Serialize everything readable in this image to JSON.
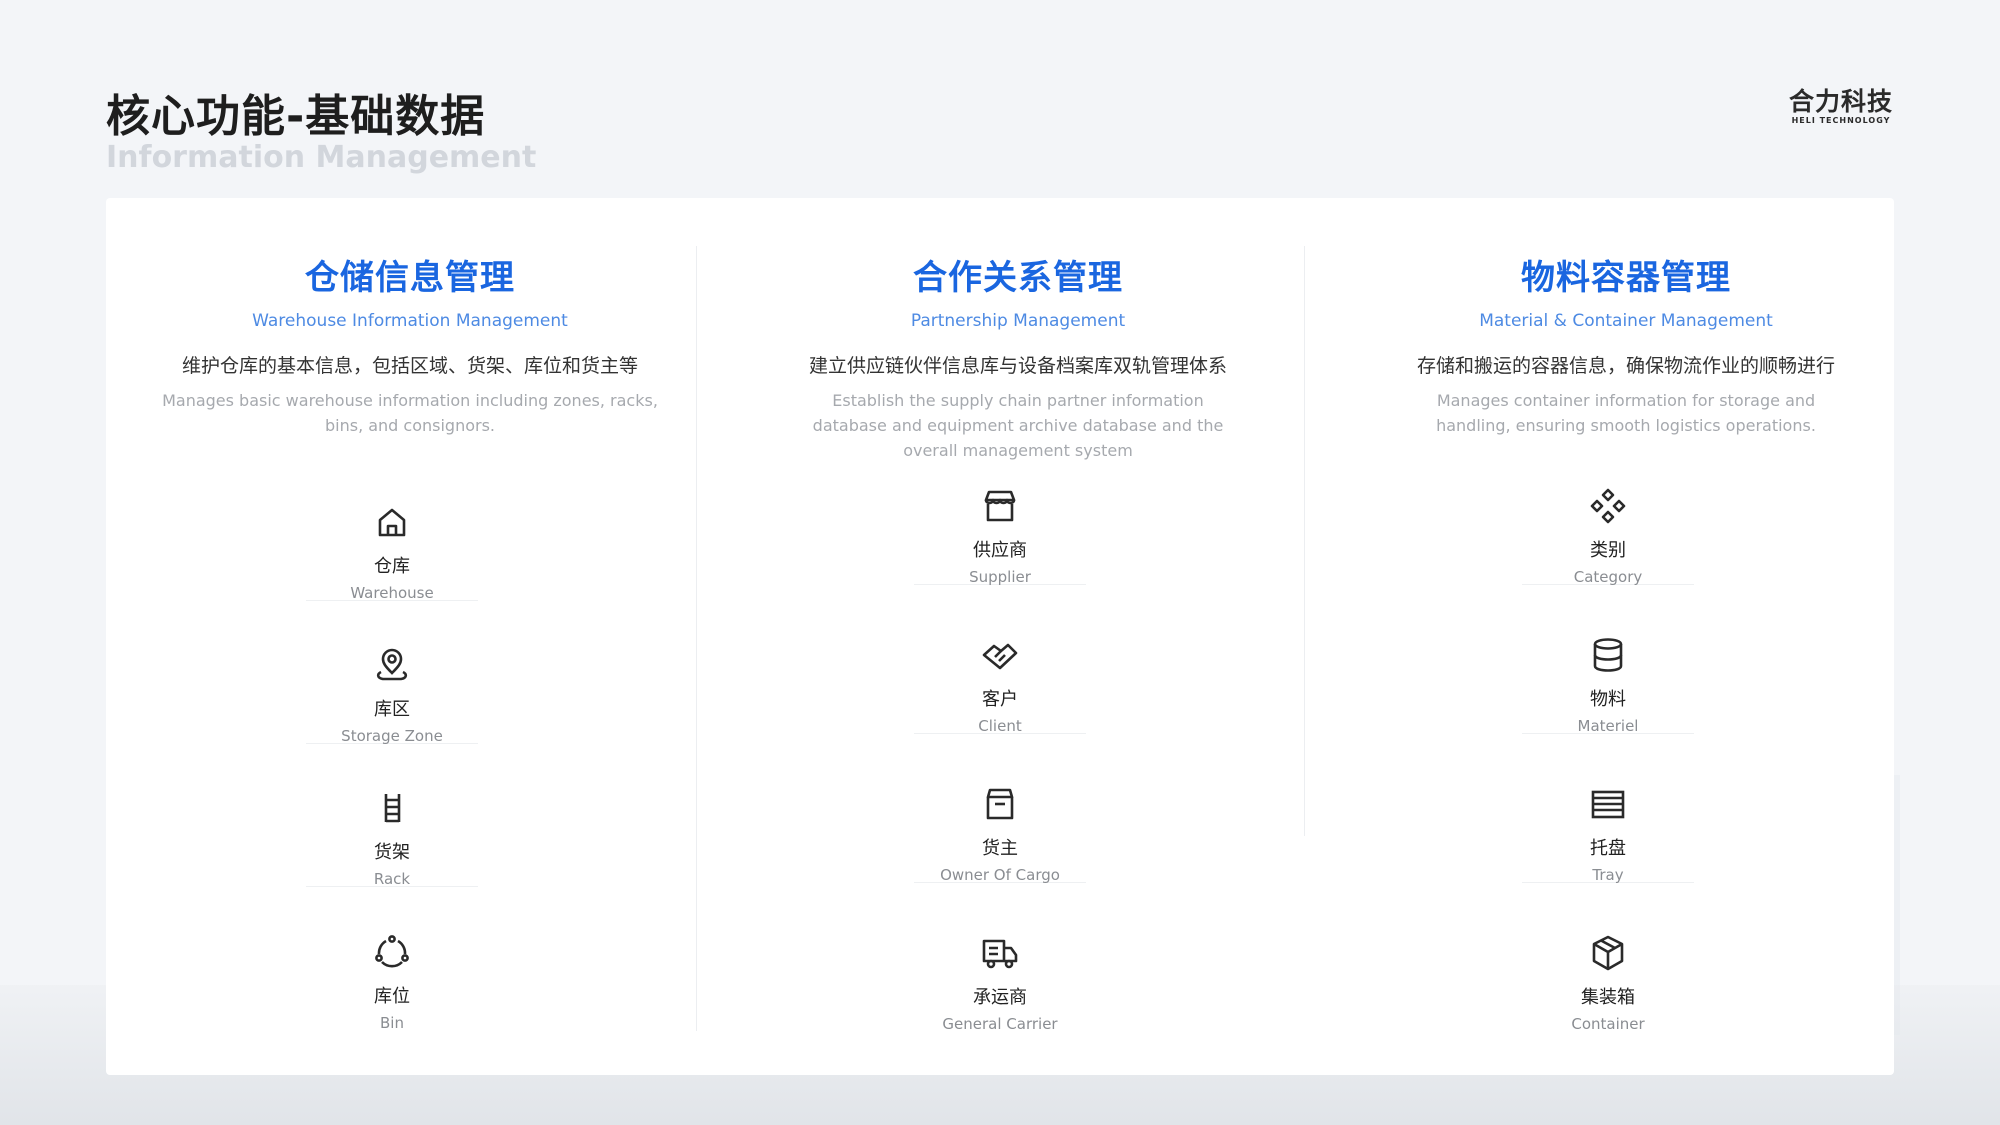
{
  "header": {
    "title": "核心功能-基础数据",
    "subtitle": "Information Management",
    "brand_name": "合力科技",
    "brand_en": "HELI TECHNOLOGY"
  },
  "columns": [
    {
      "title": "仓储信息管理",
      "subtitle": "Warehouse Information Management",
      "desc_cn": "维护仓库的基本信息，包括区域、货架、库位和货主等",
      "desc_en": "Manages basic warehouse information including zones, racks, bins, and consignors.",
      "items": [
        {
          "icon": "home-icon",
          "cn": "仓库",
          "en": "Warehouse"
        },
        {
          "icon": "location-pin-icon",
          "cn": "库区",
          "en": "Storage Zone"
        },
        {
          "icon": "ladder-rack-icon",
          "cn": "货架",
          "en": "Rack"
        },
        {
          "icon": "cycle-icon",
          "cn": "库位",
          "en": "Bin"
        }
      ]
    },
    {
      "title": "合作关系管理",
      "subtitle": "Partnership Management",
      "desc_cn": "建立供应链伙伴信息库与设备档案库双轨管理体系",
      "desc_en": "Establish the supply chain partner information database and equipment archive database and the overall management system",
      "items": [
        {
          "icon": "store-icon",
          "cn": "供应商",
          "en": "Supplier"
        },
        {
          "icon": "handshake-icon",
          "cn": "客户",
          "en": "Client"
        },
        {
          "icon": "box-icon",
          "cn": "货主",
          "en": "Owner Of Cargo"
        },
        {
          "icon": "truck-icon",
          "cn": "承运商",
          "en": "General Carrier"
        }
      ]
    },
    {
      "title": "物料容器管理",
      "subtitle": "Material & Container Management",
      "desc_cn": "存储和搬运的容器信息，确保物流作业的顺畅进行",
      "desc_en": "Manages container information for storage and handling, ensuring smooth logistics operations.",
      "items": [
        {
          "icon": "category-diamonds-icon",
          "cn": "类别",
          "en": "Category"
        },
        {
          "icon": "cylinder-icon",
          "cn": "物料",
          "en": "Materiel"
        },
        {
          "icon": "tray-stack-icon",
          "cn": "托盘",
          "en": "Tray"
        },
        {
          "icon": "cube-icon",
          "cn": "集装箱",
          "en": "Container"
        }
      ]
    }
  ]
}
